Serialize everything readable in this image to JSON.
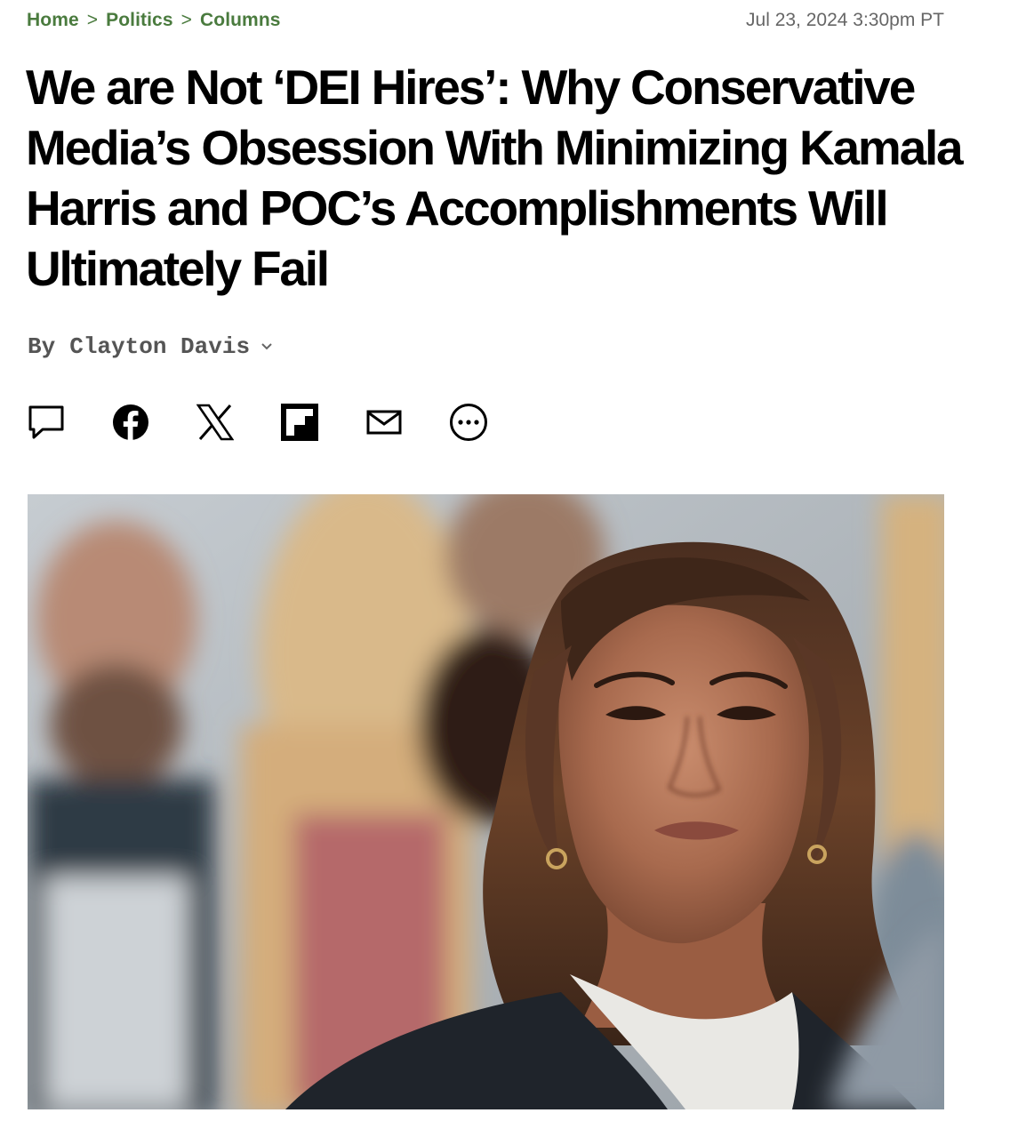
{
  "breadcrumb": {
    "items": [
      "Home",
      "Politics",
      "Columns"
    ],
    "separator": ">"
  },
  "dateline": "Jul 23, 2024 3:30pm PT",
  "headline": "We are Not ‘DEI Hires’: Why Conservative Media’s Obsession With Minimizing Kamala Harris and POC’s Accomplishments Will Ultimately Fail",
  "byline": {
    "prefix": "By",
    "author": "Clayton Davis",
    "expand_icon": "chevron-down-icon"
  },
  "share_icons": [
    "comment-icon",
    "facebook-icon",
    "x-icon",
    "flipboard-icon",
    "email-icon",
    "more-icon"
  ],
  "hero_image": {
    "alt": "Kamala Harris"
  },
  "colors": {
    "breadcrumb": "#4a7b3e",
    "dateline": "#666666",
    "headline": "#000000",
    "byline": "#555555"
  }
}
